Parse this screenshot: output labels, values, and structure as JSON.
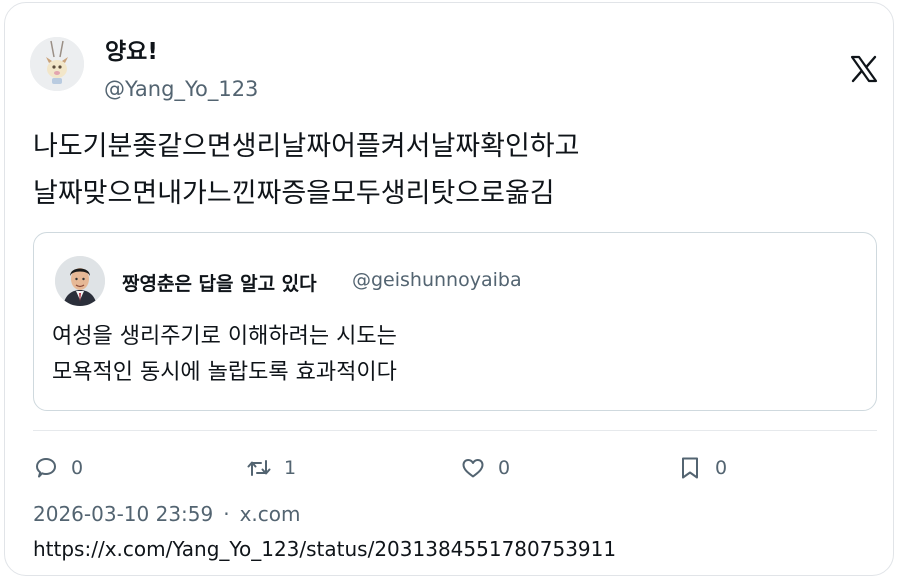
{
  "author": {
    "display_name": "양요!",
    "handle": "@Yang_Yo_123"
  },
  "tweet": {
    "lines": [
      "나도기분좆같으면생리날짜어플켜서날짜확인하고",
      "날짜맞으면내가느낀짜증을모두생리탓으로옮김"
    ]
  },
  "quoted": {
    "display_name": "짱영춘은 답을 알고 있다",
    "handle": "@geishunnoyaiba",
    "lines": [
      "여성을 생리주기로 이해하려는 시도는",
      "모욕적인 동시에 놀랍도록 효과적이다"
    ]
  },
  "actions": {
    "reply_count": "0",
    "retweet_count": "1",
    "like_count": "0",
    "bookmark_count": "0"
  },
  "meta": {
    "timestamp": "2026-03-10 23:59",
    "separator": "·",
    "source": "x.com",
    "url": "https://x.com/Yang_Yo_123/status/2031384551780753911"
  },
  "colors": {
    "text": "#0f1419",
    "secondary": "#536471",
    "border": "#cfd9de"
  },
  "icons": [
    "reply-icon",
    "retweet-icon",
    "like-icon",
    "bookmark-icon",
    "x-logo-icon"
  ]
}
